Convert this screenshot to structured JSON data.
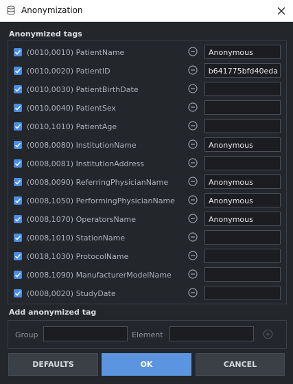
{
  "window": {
    "title": "Anonymization"
  },
  "sections": {
    "tags_label": "Anonymized tags",
    "add_label": "Add anonymized tag"
  },
  "tags": [
    {
      "label": "(0010,0010) PatientName",
      "checked": true,
      "value": "Anonymous"
    },
    {
      "label": "(0010,0020) PatientID",
      "checked": true,
      "value": "b641775bfd40eda"
    },
    {
      "label": "(0010,0030) PatientBirthDate",
      "checked": true,
      "value": ""
    },
    {
      "label": "(0010,0040) PatientSex",
      "checked": true,
      "value": ""
    },
    {
      "label": "(0010,1010) PatientAge",
      "checked": true,
      "value": ""
    },
    {
      "label": "(0008,0080) InstitutionName",
      "checked": true,
      "value": "Anonymous"
    },
    {
      "label": "(0008,0081) InstitutionAddress",
      "checked": true,
      "value": ""
    },
    {
      "label": "(0008,0090) ReferringPhysicianName",
      "checked": true,
      "value": "Anonymous"
    },
    {
      "label": "(0008,1050) PerformingPhysicianName",
      "checked": true,
      "value": "Anonymous"
    },
    {
      "label": "(0008,1070) OperatorsName",
      "checked": true,
      "value": "Anonymous"
    },
    {
      "label": "(0008,1010) StationName",
      "checked": true,
      "value": ""
    },
    {
      "label": "(0018,1030) ProtocolName",
      "checked": true,
      "value": ""
    },
    {
      "label": "(0008,1090) ManufacturerModelName",
      "checked": true,
      "value": ""
    },
    {
      "label": "(0008,0020) StudyDate",
      "checked": true,
      "value": ""
    }
  ],
  "add_tag": {
    "group_label": "Group",
    "group_value": "",
    "element_label": "Element",
    "element_value": ""
  },
  "buttons": {
    "defaults": "DEFAULTS",
    "ok": "OK",
    "cancel": "CANCEL"
  },
  "colors": {
    "accent": "#5b95e0",
    "checkbox": "#4a8de4",
    "background": "#23262b"
  },
  "icons": {
    "app": "database-icon",
    "close": "close-icon",
    "remove": "minus-circle-icon",
    "add": "plus-circle-icon",
    "check": "checkmark-icon"
  }
}
